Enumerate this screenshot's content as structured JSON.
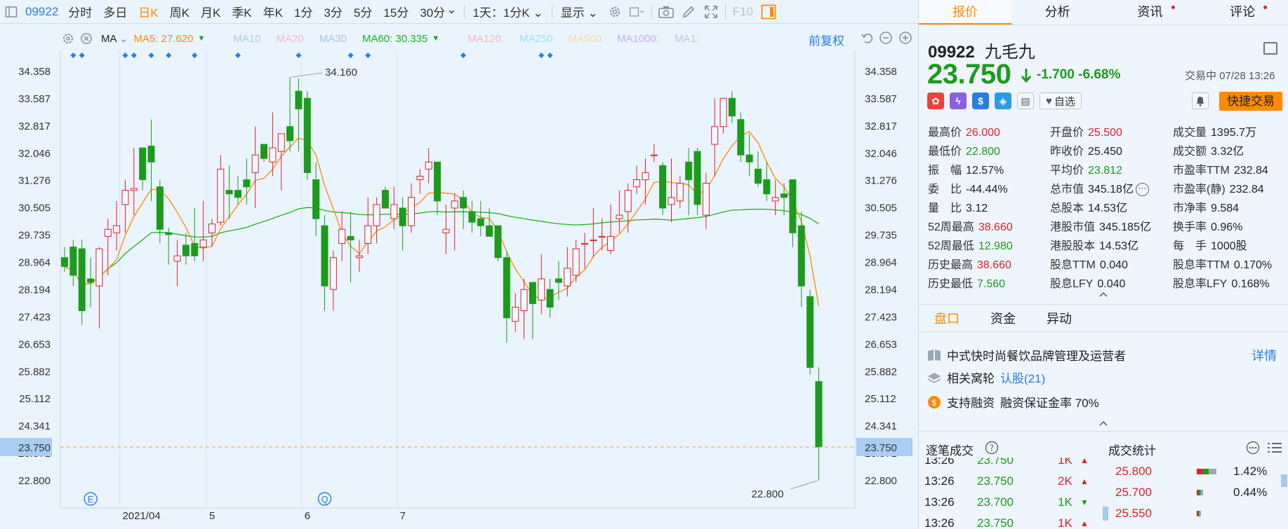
{
  "toolbar": {
    "code": "09922",
    "periods": [
      "分时",
      "多日",
      "日K",
      "周K",
      "月K",
      "季K",
      "年K",
      "1分",
      "3分",
      "5分",
      "15分",
      "30分"
    ],
    "active_period": "日K",
    "interval_select": "1天：1分K",
    "display_label": "显示",
    "fio_label": "F10"
  },
  "ma_bar": {
    "type_label": "MA",
    "ma5": {
      "label": "MA5: 27.620",
      "color": "#ff8a00"
    },
    "ma10": {
      "label": "MA10",
      "color": "#a9cbef"
    },
    "ma20": {
      "label": "MA20",
      "color": "#f0b6d6"
    },
    "ma30": {
      "label": "MA30",
      "color": "#a9c4e6"
    },
    "ma60": {
      "label": "MA60: 30.335",
      "color": "#1db31d"
    },
    "ma120": {
      "label": "MA120:",
      "color": "#f5b6bd"
    },
    "ma250": {
      "label": "MA250",
      "color": "#9ee0f5"
    },
    "ma500": {
      "label": "MA500",
      "color": "#f5dd9e"
    },
    "ma1000": {
      "label": "MA1000:",
      "color": "#c2b4ee"
    },
    "ma1": {
      "label": "MA1:",
      "color": "#b9c9dc"
    },
    "adjust": "前复权"
  },
  "chart_data": {
    "type": "candlestick",
    "y_ticks": [
      "34.358",
      "33.587",
      "32.817",
      "32.046",
      "31.276",
      "30.505",
      "29.735",
      "28.964",
      "28.194",
      "27.423",
      "26.653",
      "25.882",
      "25.112",
      "24.341",
      "23.571",
      "22.800"
    ],
    "ylim": [
      22.8,
      34.358
    ],
    "x_labels": [
      "2021/04",
      "5",
      "6",
      "7"
    ],
    "x_label_index": [
      7,
      17,
      28,
      39
    ],
    "current_price_label": "23.750",
    "high_annotation": "34.160",
    "low_annotation": "22.800",
    "event_markers": [
      "E",
      "Q"
    ],
    "event_marker_index": [
      3,
      30
    ],
    "dividend_marker_index": [
      1,
      2,
      7,
      8,
      10,
      12,
      15,
      20,
      27,
      33,
      35,
      46,
      55,
      56
    ],
    "up_color": "#e0202a",
    "down_color": "#1c9b1c",
    "ohlc": [
      [
        29.1,
        29.4,
        28.7,
        28.85
      ],
      [
        29.4,
        29.6,
        28.3,
        28.6
      ],
      [
        29.35,
        29.6,
        27.2,
        27.6
      ],
      [
        28.5,
        29.1,
        27.7,
        28.4
      ],
      [
        28.3,
        29.4,
        27.1,
        29.35
      ],
      [
        29.7,
        30.2,
        28.6,
        29.9
      ],
      [
        29.8,
        30.7,
        29.3,
        30.0
      ],
      [
        30.6,
        31.3,
        29.8,
        31.0
      ],
      [
        31.0,
        32.2,
        30.3,
        31.05
      ],
      [
        32.2,
        32.2,
        31.0,
        31.3
      ],
      [
        32.25,
        33.0,
        30.7,
        31.8
      ],
      [
        31.1,
        31.3,
        29.5,
        29.9
      ],
      [
        29.8,
        29.95,
        28.9,
        29.75
      ],
      [
        29.0,
        29.6,
        28.3,
        29.15
      ],
      [
        29.45,
        29.8,
        28.9,
        29.15
      ],
      [
        29.5,
        30.5,
        29.0,
        29.15
      ],
      [
        29.4,
        30.7,
        29.0,
        29.6
      ],
      [
        29.8,
        30.2,
        29.4,
        30.05
      ],
      [
        30.1,
        32.0,
        30.0,
        31.6
      ],
      [
        31.0,
        31.7,
        30.2,
        30.9
      ],
      [
        31.0,
        31.4,
        30.6,
        30.8
      ],
      [
        31.3,
        31.9,
        30.6,
        31.1
      ],
      [
        31.5,
        32.8,
        30.5,
        32.0
      ],
      [
        32.3,
        32.3,
        31.8,
        31.9
      ],
      [
        31.8,
        33.2,
        31.4,
        32.2
      ],
      [
        32.1,
        32.5,
        31.0,
        32.6
      ],
      [
        32.8,
        34.2,
        32.1,
        32.4
      ],
      [
        33.8,
        34.16,
        32.1,
        33.3
      ],
      [
        33.6,
        33.8,
        31.3,
        31.5
      ],
      [
        31.3,
        31.8,
        29.7,
        30.2
      ],
      [
        30.0,
        30.3,
        27.6,
        28.3
      ],
      [
        28.2,
        29.3,
        27.6,
        29.1
      ],
      [
        29.5,
        30.4,
        29.0,
        29.9
      ],
      [
        29.7,
        30.4,
        28.4,
        29.6
      ],
      [
        29.1,
        29.6,
        28.7,
        29.15
      ],
      [
        29.5,
        30.8,
        29.2,
        30.0
      ],
      [
        30.0,
        30.8,
        29.5,
        30.6
      ],
      [
        31.0,
        31.1,
        30.5,
        30.5
      ],
      [
        30.2,
        31.1,
        29.9,
        30.6
      ],
      [
        30.5,
        30.8,
        29.3,
        30.0
      ],
      [
        30.0,
        31.2,
        29.8,
        30.8
      ],
      [
        31.3,
        31.6,
        30.9,
        31.4
      ],
      [
        31.6,
        32.2,
        31.2,
        31.8
      ],
      [
        31.8,
        31.8,
        30.3,
        30.7
      ],
      [
        29.8,
        30.6,
        29.2,
        29.9
      ],
      [
        30.5,
        30.9,
        29.3,
        30.7
      ],
      [
        30.8,
        31.0,
        29.9,
        30.5
      ],
      [
        30.4,
        30.7,
        29.8,
        30.1
      ],
      [
        30.2,
        30.7,
        29.7,
        30.0
      ],
      [
        30.0,
        30.5,
        29.8,
        29.7
      ],
      [
        30.0,
        30.0,
        29.0,
        29.1
      ],
      [
        29.1,
        29.3,
        26.7,
        27.4
      ],
      [
        27.3,
        28.1,
        27.0,
        27.7
      ],
      [
        27.6,
        28.5,
        26.8,
        28.2
      ],
      [
        28.4,
        28.4,
        26.8,
        27.8
      ],
      [
        27.9,
        29.2,
        27.5,
        28.5
      ],
      [
        28.2,
        28.5,
        27.4,
        27.7
      ],
      [
        28.5,
        29.0,
        27.9,
        28.4
      ],
      [
        28.3,
        29.4,
        28.0,
        28.8
      ],
      [
        28.6,
        29.6,
        28.4,
        29.35
      ],
      [
        29.5,
        29.8,
        28.8,
        29.5
      ],
      [
        29.6,
        30.5,
        29.1,
        29.6
      ],
      [
        29.7,
        30.2,
        29.3,
        29.7
      ],
      [
        29.3,
        30.6,
        29.2,
        29.7
      ],
      [
        30.2,
        31.0,
        29.8,
        30.3
      ],
      [
        30.4,
        31.2,
        29.8,
        31.0
      ],
      [
        31.1,
        31.7,
        30.9,
        31.3
      ],
      [
        31.3,
        31.9,
        30.6,
        31.5
      ],
      [
        32.0,
        32.3,
        31.8,
        32.0
      ],
      [
        31.7,
        31.8,
        30.3,
        30.5
      ],
      [
        30.6,
        31.9,
        30.1,
        30.8
      ],
      [
        30.7,
        31.4,
        30.5,
        31.2
      ],
      [
        31.8,
        32.2,
        30.3,
        31.3
      ],
      [
        32.1,
        32.2,
        30.3,
        30.6
      ],
      [
        30.3,
        31.5,
        29.9,
        31.2
      ],
      [
        32.3,
        33.6,
        31.4,
        32.8
      ],
      [
        32.8,
        33.6,
        32.6,
        33.6
      ],
      [
        33.6,
        33.8,
        32.9,
        33.1
      ],
      [
        33.0,
        33.2,
        31.8,
        32.0
      ],
      [
        32.0,
        32.6,
        31.4,
        31.8
      ],
      [
        31.6,
        32.1,
        31.1,
        31.2
      ],
      [
        31.3,
        31.8,
        30.7,
        30.9
      ],
      [
        30.7,
        31.3,
        30.3,
        30.8
      ],
      [
        30.9,
        31.2,
        30.3,
        30.8
      ],
      [
        31.3,
        31.3,
        29.4,
        29.8
      ],
      [
        30.0,
        30.4,
        27.7,
        28.3
      ],
      [
        28.0,
        28.2,
        25.8,
        26.0
      ],
      [
        25.6,
        26.0,
        22.8,
        23.75
      ]
    ]
  },
  "right": {
    "tabs": [
      {
        "label": "报价",
        "dot": false
      },
      {
        "label": "分析",
        "dot": false
      },
      {
        "label": "资讯",
        "dot": true
      },
      {
        "label": "评论",
        "dot": true
      }
    ],
    "code": "09922",
    "name": "九毛九",
    "price": "23.750",
    "change": "-1.700",
    "change_pct": "-6.68%",
    "trade_status": "交易中 07/28 13:26",
    "watchlist_label": "自选",
    "quick_trade": "快捷交易",
    "quote_cols": [
      [
        {
          "label": "最高价",
          "value": "26.000",
          "color": "red"
        },
        {
          "label": "最低价",
          "value": "22.800",
          "color": "green"
        },
        {
          "label": "振　幅",
          "value": "12.57%",
          "color": "dark"
        },
        {
          "label": "委　比",
          "value": "-44.44%",
          "color": "dark"
        },
        {
          "label": "量　比",
          "value": "3.12",
          "color": "dark"
        },
        {
          "label": "52周最高",
          "value": "38.660",
          "color": "red"
        },
        {
          "label": "52周最低",
          "value": "12.980",
          "color": "green"
        },
        {
          "label": "历史最高",
          "value": "38.660",
          "color": "red"
        },
        {
          "label": "历史最低",
          "value": "7.560",
          "color": "green"
        }
      ],
      [
        {
          "label": "开盘价",
          "value": "25.500",
          "color": "red"
        },
        {
          "label": "昨收价",
          "value": "25.450",
          "color": "dark"
        },
        {
          "label": "平均价",
          "value": "23.812",
          "color": "green"
        },
        {
          "label": "总市值",
          "value": "345.18亿",
          "color": "dark"
        },
        {
          "label": "总股本",
          "value": "14.53亿",
          "color": "dark"
        },
        {
          "label": "港股市值",
          "value": "345.185亿",
          "color": "dark"
        },
        {
          "label": "港股股本",
          "value": "14.53亿",
          "color": "dark"
        },
        {
          "label": "股息TTM",
          "value": "0.040",
          "color": "dark"
        },
        {
          "label": "股息LFY",
          "value": "0.040",
          "color": "dark"
        }
      ],
      [
        {
          "label": "成交量",
          "value": "1395.7万",
          "color": "dark"
        },
        {
          "label": "成交额",
          "value": "3.32亿",
          "color": "dark"
        },
        {
          "label": "市盈率TTM",
          "value": "232.84",
          "color": "dark"
        },
        {
          "label": "市盈率(静)",
          "value": "232.84",
          "color": "dark"
        },
        {
          "label": "市净率",
          "value": "9.584",
          "color": "dark"
        },
        {
          "label": "换手率",
          "value": "0.96%",
          "color": "dark"
        },
        {
          "label": "每　手",
          "value": "1000股",
          "color": "dark"
        },
        {
          "label": "股息率TTM",
          "value": "0.170%",
          "color": "dark"
        },
        {
          "label": "股息率LFY",
          "value": "0.168%",
          "color": "dark"
        }
      ]
    ],
    "sub_tabs": [
      "盘口",
      "资金",
      "异动"
    ],
    "desc": "中式快时尚餐饮品牌管理及运营者",
    "detail": "详情",
    "related_label": "相关窝轮",
    "related_link": "认股(21)",
    "margin_label": "支持融资",
    "margin_rate": "融资保证金率 70%",
    "tick_title": "逐笔成交",
    "stat_title": "成交统计",
    "ticks": [
      {
        "time": "13:26",
        "price": "23.750",
        "vol": "1K",
        "dir": "up"
      },
      {
        "time": "13:26",
        "price": "23.750",
        "vol": "2K",
        "dir": "up"
      },
      {
        "time": "13:26",
        "price": "23.700",
        "vol": "1K",
        "dir": "down"
      },
      {
        "time": "13:26",
        "price": "23.750",
        "vol": "1K",
        "dir": "up"
      }
    ],
    "stats": [
      {
        "price": "25.800",
        "pct": "1.42%",
        "pct_value": 1.42
      },
      {
        "price": "25.700",
        "pct": "0.44%",
        "pct_value": 0.44
      },
      {
        "price": "25.550",
        "pct": "",
        "pct_value": 0.3
      }
    ]
  }
}
